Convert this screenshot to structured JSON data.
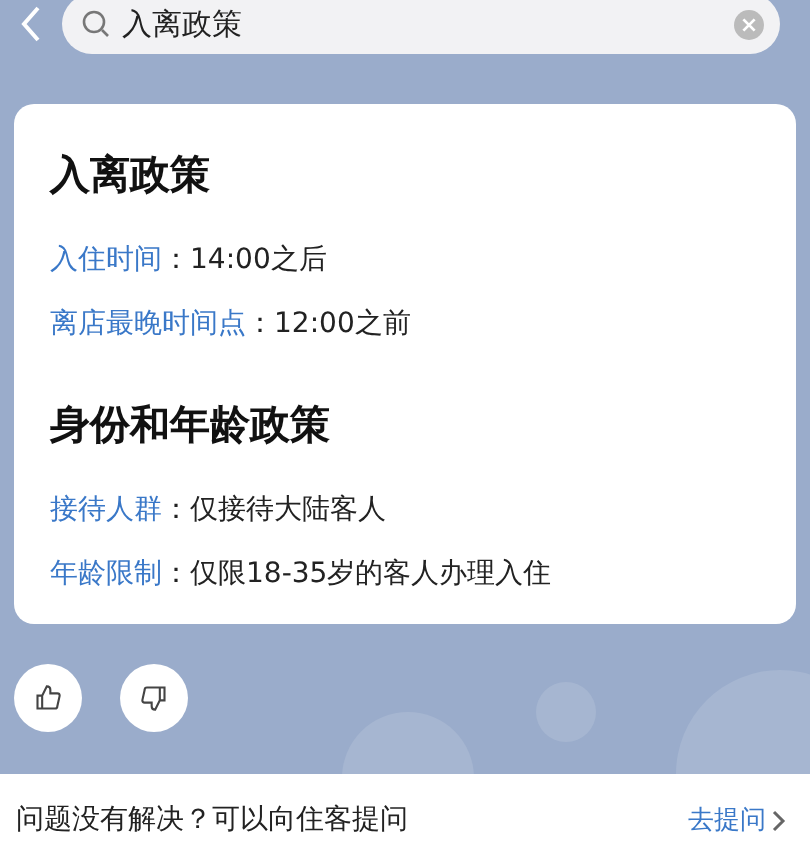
{
  "search": {
    "value": "入离政策"
  },
  "sections": [
    {
      "title": "入离政策",
      "rows": [
        {
          "label": "入住时间",
          "value": "：14:00之后"
        },
        {
          "label": "离店最晚时间点",
          "value": "：12:00之前"
        }
      ]
    },
    {
      "title": "身份和年龄政策",
      "rows": [
        {
          "label": "接待人群",
          "value": "：仅接待大陆客人"
        },
        {
          "label": "年龄限制",
          "value": "：仅限18-35岁的客人办理入住"
        }
      ]
    }
  ],
  "feedback": [
    {
      "kind": "like"
    },
    {
      "kind": "dislike"
    }
  ],
  "footer": {
    "text": "问题没有解决？可以向住客提问",
    "link": "去提问"
  }
}
